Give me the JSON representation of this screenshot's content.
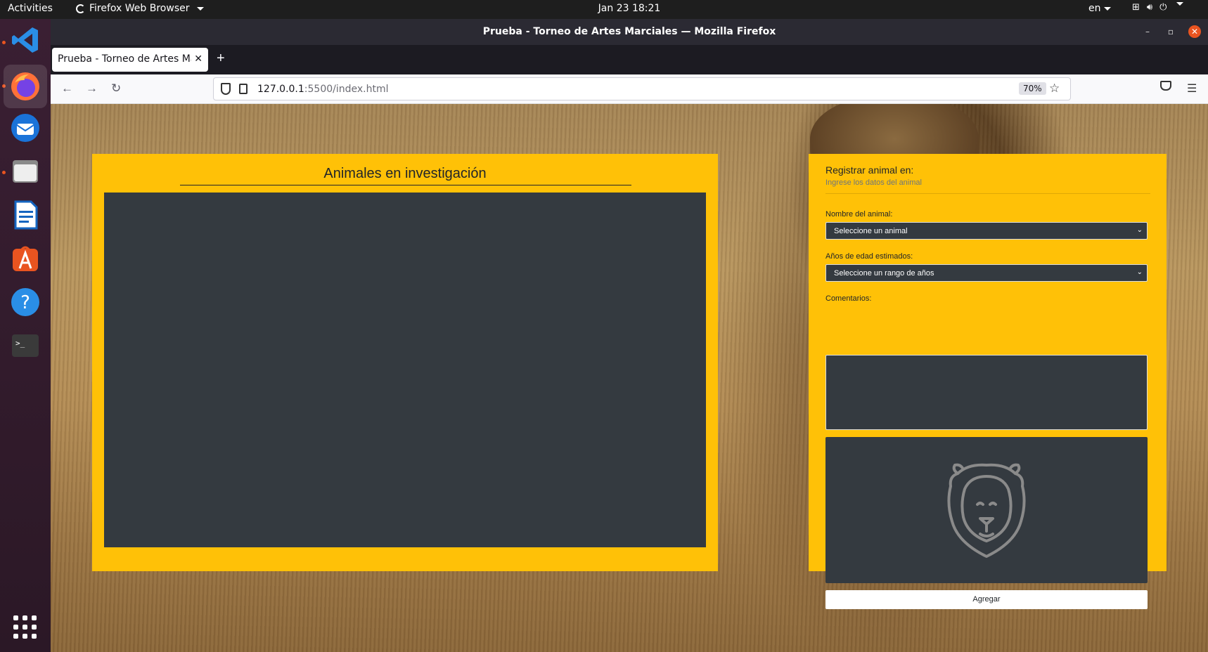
{
  "topbar": {
    "activities": "Activities",
    "app_menu": "Firefox Web Browser",
    "clock": "Jan 23  18:21",
    "language": "en"
  },
  "dock": {
    "items": [
      "vscode-icon",
      "firefox-icon",
      "thunderbird-icon",
      "files-icon",
      "writer-icon",
      "software-icon",
      "help-icon",
      "terminal-icon"
    ],
    "help_glyph": "?",
    "terminal_glyph": ">_"
  },
  "window": {
    "title": "Prueba - Torneo de Artes Marciales — Mozilla Firefox"
  },
  "tabs": [
    {
      "label": "Prueba - Torneo de Artes Marciales",
      "close": "✕"
    }
  ],
  "navbar": {
    "url_host": "127.0.0.1",
    "url_path": ":5500/index.html",
    "zoom": "70%"
  },
  "page": {
    "left_heading": "Animales en investigación",
    "form": {
      "title": "Registrar animal en:",
      "subtitle": "Ingrese los datos del animal",
      "animal_label": "Nombre del animal:",
      "animal_selected": "Seleccione un animal",
      "age_label": "Años de edad estimados:",
      "age_selected": "Seleccione un rango de años",
      "comments_label": "Comentarios:",
      "submit": "Agregar"
    }
  },
  "colors": {
    "panel": "#ffc107",
    "dark": "#343a40",
    "accent": "#e95420"
  }
}
